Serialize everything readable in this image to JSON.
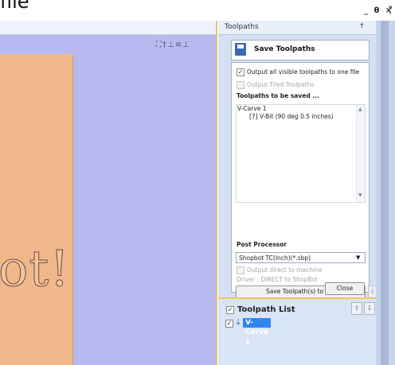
{
  "window": {
    "title_fragment": "file",
    "controls": "_ θ ×",
    "extra_marks": "▪\n•"
  },
  "view": {
    "toolbar_icons": "⛶†⊥≡⊥",
    "wood_text": "ot!"
  },
  "toolpaths_panel": {
    "title": "Toolpaths",
    "pin": "†",
    "save_title": "Save Toolpaths",
    "output_all_label": "Output all visible toolpaths to one file",
    "output_all_checked": "✓",
    "output_tiled_label": "Output Tiled Toolpaths",
    "to_be_saved_heading": "Toolpaths to be saved ...",
    "tree": {
      "group": "V-Carve 1",
      "child": "[7] V-Bit (90 deg 0.5 inches)"
    },
    "scroll_up": "▲",
    "scroll_down": "▼",
    "post_processor_heading": "Post Processor",
    "post_processor_value": "Shopbot TC(Inch)(*.sbp)",
    "dropdown_arrow": "▼",
    "output_direct_label": "Output direct to machine",
    "driver_label": "Driver : DIRECT to ShopBot",
    "save_file_button": "Save Toolpath(s) to File",
    "close_button": "Close",
    "side_scroll_down": "⇩"
  },
  "toolpath_list": {
    "title": "Toolpath List",
    "header_checked": "✓",
    "up_arrow": "⇧",
    "down_arrow": "⇩",
    "items": [
      {
        "checked": "✓",
        "icon": "⇣",
        "label": "V-Carve 1"
      }
    ]
  },
  "colors": {
    "view_background": "#b9b9f2",
    "wood": "#f0b88a",
    "panel_background": "#d5e1f3",
    "selection": "#2f86f0",
    "divider_accent": "#f0c65a"
  }
}
